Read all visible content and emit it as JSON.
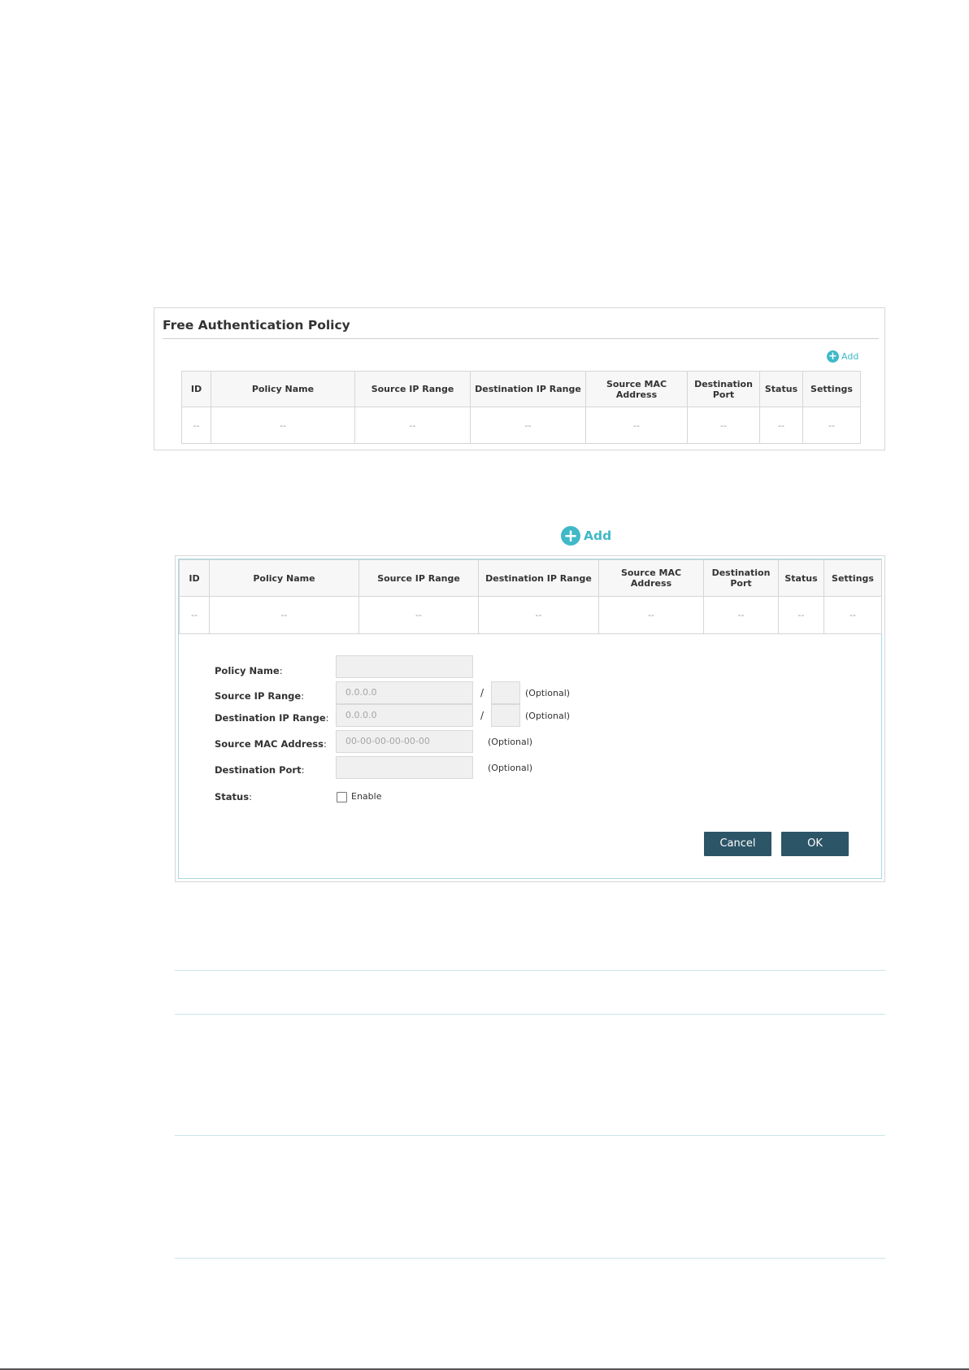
{
  "panel1": {
    "title": "Free Authentication Policy",
    "add_label": "Add"
  },
  "table": {
    "headers": {
      "id": "ID",
      "policy_name": "Policy Name",
      "source_ip": "Source IP Range",
      "dest_ip": "Destination IP Range",
      "source_mac": "Source MAC Address",
      "dest_port": "Destination Port",
      "status": "Status",
      "settings": "Settings"
    },
    "empty_cell": "--"
  },
  "panel2": {
    "add_label": "Add"
  },
  "form": {
    "policy_name_label": "Policy Name",
    "source_ip_label": "Source IP Range",
    "source_ip_placeholder": "0.0.0.0",
    "dest_ip_label": "Destination IP Range",
    "dest_ip_placeholder": "0.0.0.0",
    "source_mac_label": "Source MAC Address",
    "source_mac_placeholder": "00-00-00-00-00-00",
    "dest_port_label": "Destination Port",
    "status_label": "Status",
    "colon": ":",
    "slash": "/",
    "optional": "(Optional)",
    "enable_label": "Enable",
    "enable_checked": false,
    "cancel_label": "Cancel",
    "ok_label": "OK"
  },
  "colors": {
    "accent": "#3fb9c8",
    "button_bg": "#2c5567",
    "border": "#d6d6d6",
    "field_bg": "#f0f0f0"
  }
}
